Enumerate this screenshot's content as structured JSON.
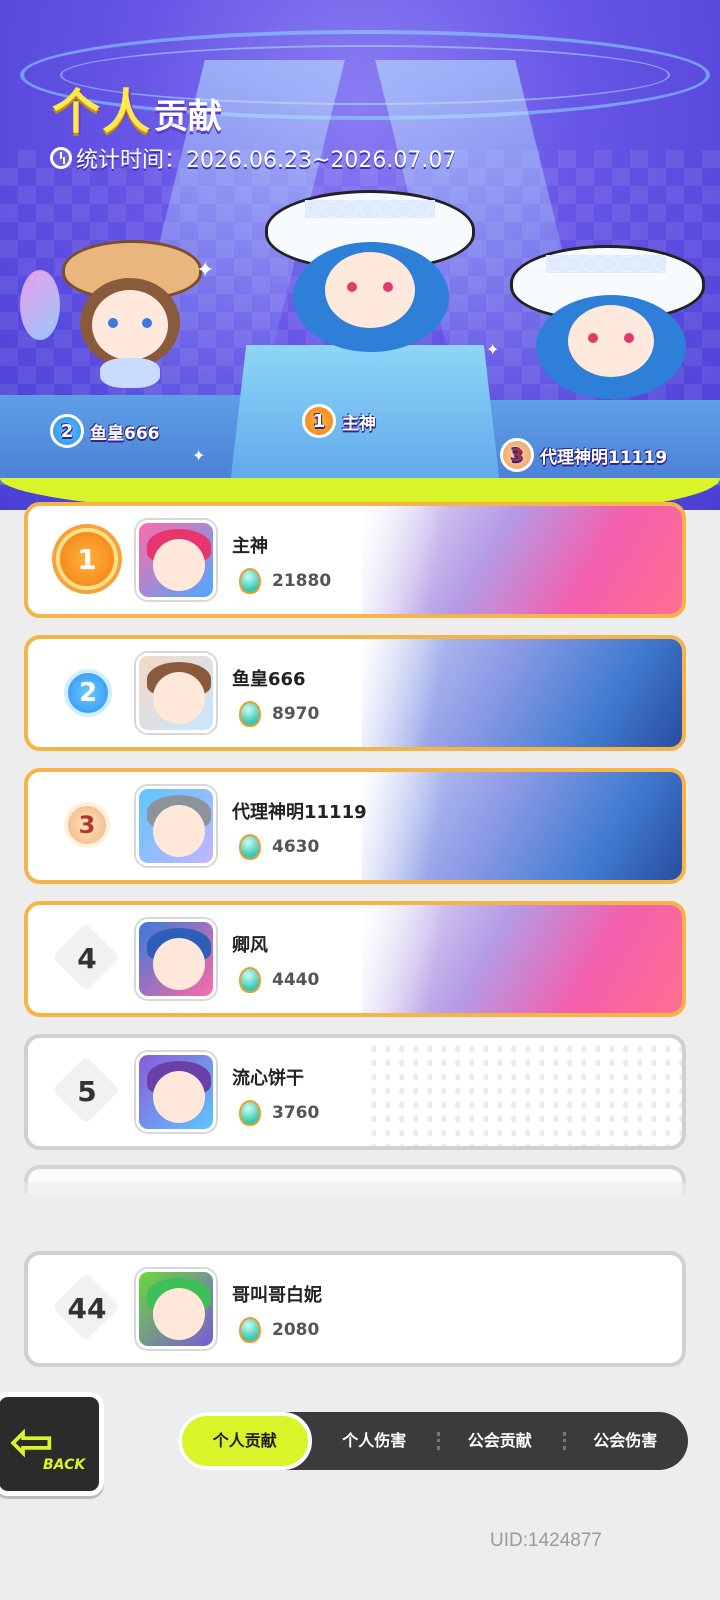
{
  "header": {
    "title_big": "个人",
    "title_small": "贡献",
    "period": "统计时间：2026.06.23~2026.07.07"
  },
  "podium": [
    {
      "rank": "2",
      "name": "鱼皇666"
    },
    {
      "rank": "1",
      "name": "主神"
    },
    {
      "rank": "3",
      "name": "代理神明11119"
    }
  ],
  "ranking": [
    {
      "rank": "1",
      "name": "主神",
      "score": "21880"
    },
    {
      "rank": "2",
      "name": "鱼皇666",
      "score": "8970"
    },
    {
      "rank": "3",
      "name": "代理神明11119",
      "score": "4630"
    },
    {
      "rank": "4",
      "name": "卿风",
      "score": "4440"
    },
    {
      "rank": "5",
      "name": "流心饼干",
      "score": "3760"
    }
  ],
  "self_row": {
    "rank": "44",
    "name": "哥叫哥白妮",
    "score": "2080"
  },
  "back_button": {
    "label": "BACK",
    "icon": "back-arrow-icon"
  },
  "tabs": [
    "个人贡献",
    "个人伤害",
    "公会贡献",
    "公会伤害"
  ],
  "uid": "UID:1424877",
  "colors": {
    "accent": "#d9f52a",
    "header": "#6655e6",
    "top_border": "#f6b348"
  }
}
